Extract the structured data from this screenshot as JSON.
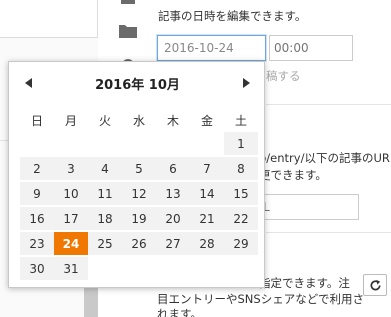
{
  "right": {
    "edit_datetime_text": "記事の日時を編集できます。",
    "date_value": "2016-10-24",
    "time_placeholder": "00:00",
    "partial_hint": "稿する",
    "url_text_line1": "p/entry/以下の記事のUR",
    "url_text_line2": "更できます。",
    "url_placeholder": "L",
    "spec_text_line1": "指定できます。注",
    "spec_text_line2": "目エントリーやSNSシェアなどで利用さ",
    "spec_text_line3": "れます。"
  },
  "icons": {
    "folder": "folder-icon",
    "gear": "gear-icon",
    "prev": "chevron-left-icon",
    "next": "chevron-right-icon",
    "refresh": "refresh-icon"
  },
  "colors": {
    "selected": "#f07800",
    "focus_border": "#6fa8dc",
    "day_bg": "#f2f2f2"
  },
  "calendar": {
    "title": "2016年 10月",
    "weekdays": [
      "日",
      "月",
      "火",
      "水",
      "木",
      "金",
      "土"
    ],
    "selected_day": "24",
    "weeks": [
      [
        "",
        "",
        "",
        "",
        "",
        "",
        "1"
      ],
      [
        "2",
        "3",
        "4",
        "5",
        "6",
        "7",
        "8"
      ],
      [
        "9",
        "10",
        "11",
        "12",
        "13",
        "14",
        "15"
      ],
      [
        "16",
        "17",
        "18",
        "19",
        "20",
        "21",
        "22"
      ],
      [
        "23",
        "24",
        "25",
        "26",
        "27",
        "28",
        "29"
      ],
      [
        "30",
        "31",
        "",
        "",
        "",
        "",
        ""
      ]
    ]
  }
}
